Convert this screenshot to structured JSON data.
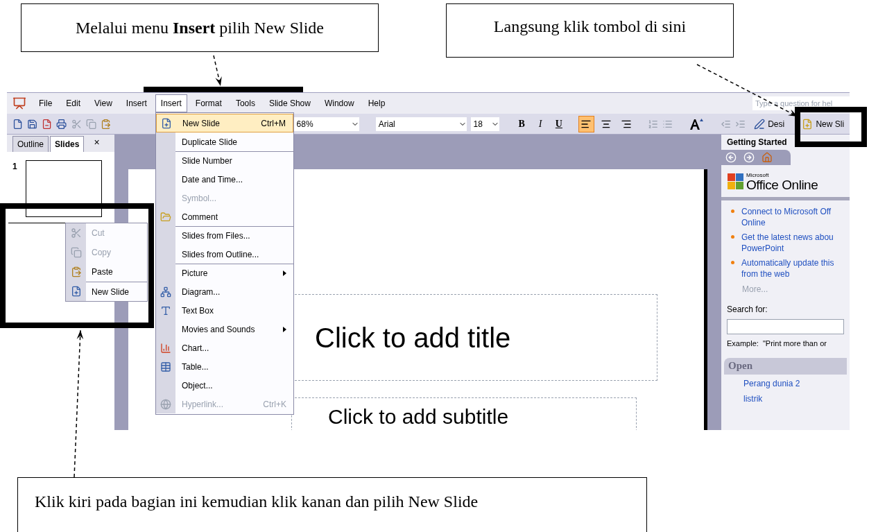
{
  "callouts": [
    {
      "text": "Melalui menu **Insert** pilih New Slide"
    },
    {
      "text": "Langsung klik tombol di sini"
    },
    {
      "text": "Klik kiri pada bagian ini kemudian klik kanan dan pilih New Slide"
    }
  ],
  "menu_bar": {
    "items": [
      {
        "label": "File",
        "selected": false
      },
      {
        "label": "Edit",
        "selected": false
      },
      {
        "label": "View",
        "selected": false
      },
      {
        "label": "Insert",
        "selected": false
      },
      {
        "label": "Insert",
        "selected": true
      },
      {
        "label": "Format",
        "selected": false
      },
      {
        "label": "Tools",
        "selected": false
      },
      {
        "label": "Slide Show",
        "selected": false
      },
      {
        "label": "Window",
        "selected": false
      },
      {
        "label": "Help",
        "selected": false
      }
    ],
    "help_placeholder": "Type a question for hel"
  },
  "toolbar": {
    "zoom": "68%",
    "font": "Arial",
    "size": "18",
    "bold": "B",
    "italic": "I",
    "underline": "U",
    "align": [
      {
        "kind": "left",
        "selected": true
      },
      {
        "kind": "center",
        "selected": false
      },
      {
        "kind": "right",
        "selected": false
      }
    ],
    "design": "Desi",
    "new_slide": "New Sli"
  },
  "slides_pane": {
    "tabs": [
      {
        "label": "Outline",
        "selected": false
      },
      {
        "label": "Slides",
        "selected": true
      }
    ],
    "close": "×",
    "slide_number": "1"
  },
  "insert_menu": {
    "items": [
      {
        "label": "New Slide",
        "shortcut": "Ctrl+M",
        "selected": true,
        "disabled": false,
        "separator_before": false,
        "submenu": false
      },
      {
        "label": "Duplicate Slide",
        "selected": false,
        "disabled": false,
        "separator_before": false,
        "submenu": false
      },
      {
        "label": "Slide Number",
        "selected": false,
        "disabled": false,
        "separator_before": true,
        "submenu": false
      },
      {
        "label": "Date and Time...",
        "selected": false,
        "disabled": false,
        "separator_before": false,
        "submenu": false
      },
      {
        "label": "Symbol...",
        "selected": false,
        "disabled": true,
        "separator_before": false,
        "submenu": false
      },
      {
        "label": "Comment",
        "selected": false,
        "disabled": false,
        "separator_before": false,
        "submenu": false
      },
      {
        "label": "Slides from Files...",
        "selected": false,
        "disabled": false,
        "separator_before": true,
        "submenu": false
      },
      {
        "label": "Slides from Outline...",
        "selected": false,
        "disabled": false,
        "separator_before": false,
        "submenu": false
      },
      {
        "label": "Picture",
        "selected": false,
        "disabled": false,
        "separator_before": true,
        "submenu": true
      },
      {
        "label": "Diagram...",
        "selected": false,
        "disabled": false,
        "separator_before": false,
        "submenu": false
      },
      {
        "label": "Text Box",
        "selected": false,
        "disabled": false,
        "separator_before": false,
        "submenu": false
      },
      {
        "label": "Movies and Sounds",
        "selected": false,
        "disabled": false,
        "separator_before": false,
        "submenu": true
      },
      {
        "label": "Chart...",
        "selected": false,
        "disabled": false,
        "separator_before": false,
        "submenu": false
      },
      {
        "label": "Table...",
        "selected": false,
        "disabled": false,
        "separator_before": false,
        "submenu": false
      },
      {
        "label": "Object...",
        "selected": false,
        "disabled": false,
        "separator_before": false,
        "submenu": false
      },
      {
        "label": "Hyperlink...",
        "shortcut": "Ctrl+K",
        "selected": false,
        "disabled": true,
        "separator_before": false,
        "submenu": false
      }
    ]
  },
  "context_menu": {
    "items": [
      {
        "label": "Cut",
        "disabled": true,
        "separator_before": false
      },
      {
        "label": "Copy",
        "disabled": true,
        "separator_before": false
      },
      {
        "label": "Paste",
        "disabled": false,
        "separator_before": false
      },
      {
        "label": "New Slide",
        "disabled": false,
        "separator_before": true
      }
    ]
  },
  "slide": {
    "title_placeholder": "Click to add title",
    "subtitle_placeholder": "Click to add subtitle"
  },
  "task_pane": {
    "title": "Getting Started",
    "logo_small": "Microsoft",
    "logo": "Office Online",
    "links": [
      {
        "lines": [
          "Connect to Microsoft Off",
          "Online"
        ]
      },
      {
        "lines": [
          "Get the latest news abou",
          "PowerPoint"
        ]
      },
      {
        "lines": [
          "Automatically update this",
          "from the web"
        ]
      }
    ],
    "more": "More...",
    "search_label": "Search for:",
    "example": "Example:  \"Print more than or",
    "open_heading": "Open",
    "recent": [
      "Perang dunia 2",
      "listrik"
    ]
  }
}
